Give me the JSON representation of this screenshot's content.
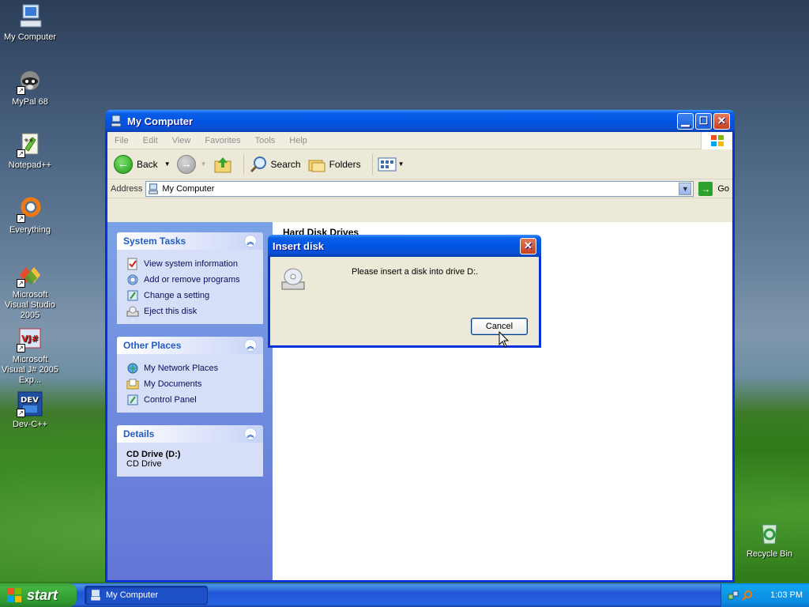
{
  "desktop": {
    "icons": [
      {
        "label": "My Computer"
      },
      {
        "label": "MyPal 68"
      },
      {
        "label": "Notepad++"
      },
      {
        "label": "Everything"
      },
      {
        "label": "Microsoft Visual Studio 2005"
      },
      {
        "label": "Microsoft Visual J# 2005 Exp..."
      },
      {
        "label": "Dev-C++"
      },
      {
        "label": "Recycle Bin"
      }
    ]
  },
  "window": {
    "title": "My Computer",
    "menu": [
      "File",
      "Edit",
      "View",
      "Favorites",
      "Tools",
      "Help"
    ],
    "toolbar": {
      "back": "Back",
      "search": "Search",
      "folders": "Folders"
    },
    "address": {
      "label": "Address",
      "value": "My Computer",
      "go": "Go"
    },
    "panels": {
      "system_tasks": {
        "title": "System Tasks",
        "items": [
          "View system information",
          "Add or remove programs",
          "Change a setting",
          "Eject this disk"
        ]
      },
      "other_places": {
        "title": "Other Places",
        "items": [
          "My Network Places",
          "My Documents",
          "Control Panel"
        ]
      },
      "details": {
        "title": "Details",
        "name": "CD Drive (D:)",
        "type": "CD Drive"
      }
    },
    "content": {
      "group_title": "Hard Disk Drives"
    }
  },
  "dialog": {
    "title": "Insert disk",
    "message": "Please insert a disk into drive D:.",
    "cancel": "Cancel"
  },
  "taskbar": {
    "start": "start",
    "task_button": "My Computer",
    "clock": "1:03 PM"
  },
  "colors": {
    "titlebar_blue": "#0054e3",
    "taskpane_blue": "#6375d6",
    "start_green": "#41b341"
  }
}
